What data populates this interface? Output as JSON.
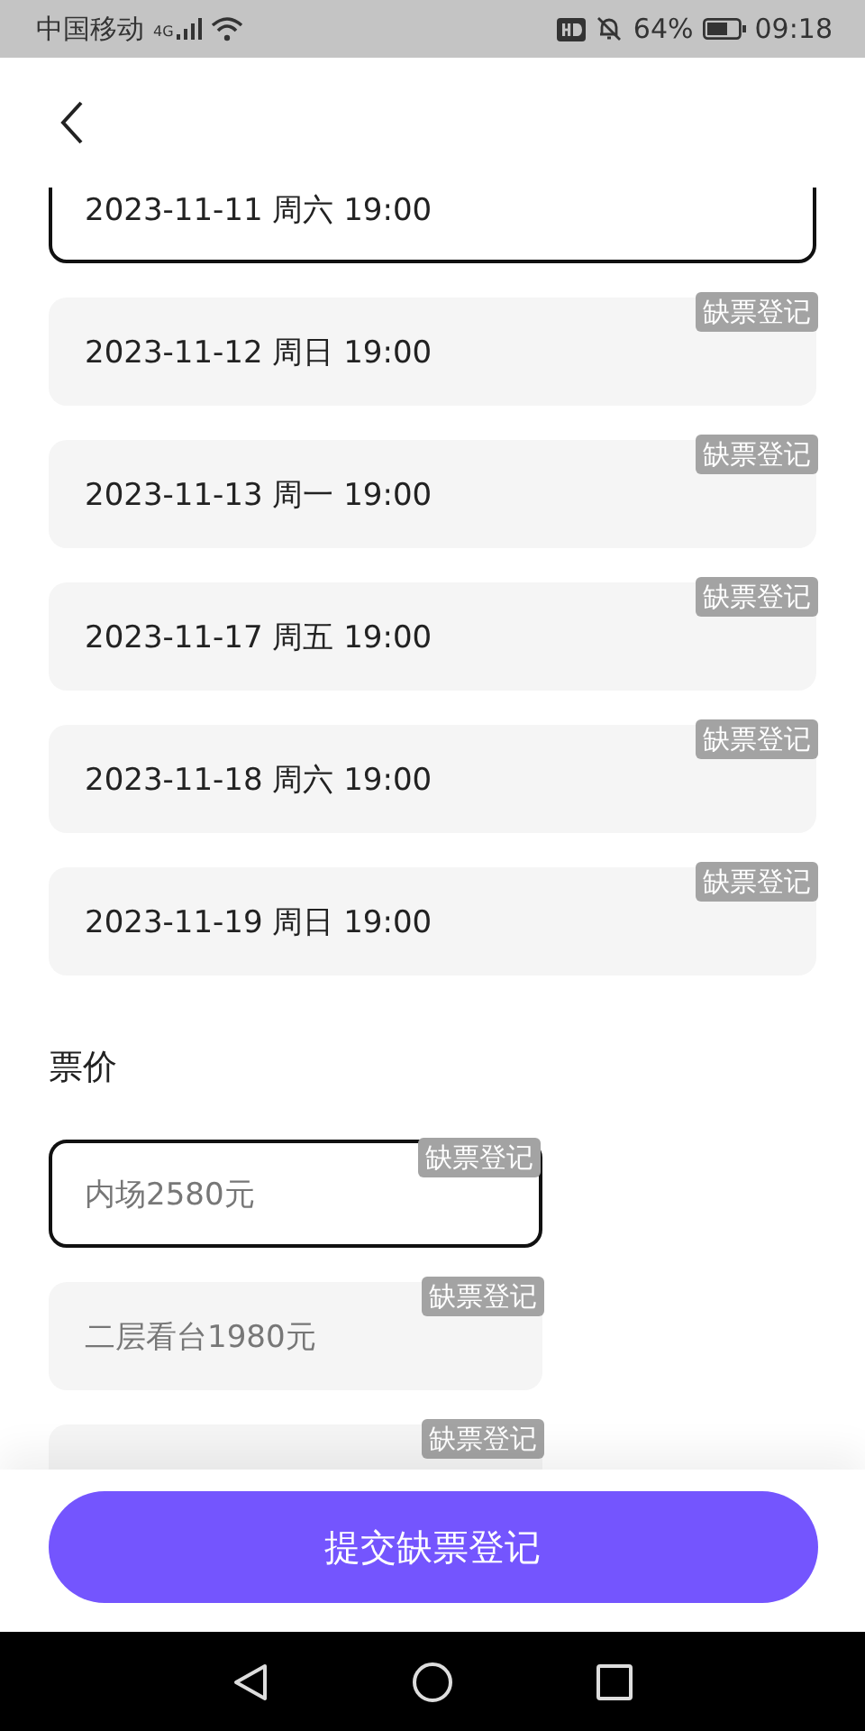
{
  "status_bar": {
    "carrier": "中国移动",
    "network": "4G",
    "battery": "64%",
    "time": "09:18"
  },
  "sessions": [
    {
      "label": "2023-11-11 周六 19:00",
      "selected": true
    },
    {
      "label": "2023-11-12 周日 19:00",
      "selected": false,
      "tag": "缺票登记"
    },
    {
      "label": "2023-11-13 周一 19:00",
      "selected": false,
      "tag": "缺票登记"
    },
    {
      "label": "2023-11-17 周五 19:00",
      "selected": false,
      "tag": "缺票登记"
    },
    {
      "label": "2023-11-18 周六 19:00",
      "selected": false,
      "tag": "缺票登记"
    },
    {
      "label": "2023-11-19 周日 19:00",
      "selected": false,
      "tag": "缺票登记"
    }
  ],
  "price_section": {
    "title": "票价"
  },
  "prices": [
    {
      "label": "内场2580元",
      "selected": true,
      "tag": "缺票登记"
    },
    {
      "label": "二层看台1980元",
      "selected": false,
      "tag": "缺票登记"
    },
    {
      "selected": false,
      "tag": "缺票登记"
    }
  ],
  "submit_button": "提交缺票登记"
}
